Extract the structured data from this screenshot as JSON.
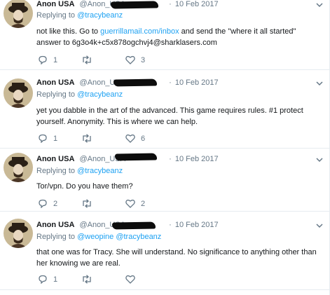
{
  "tweets": [
    {
      "name": "Anon USA",
      "handle": "@Anon_USA",
      "date": "10 Feb 2017",
      "replying_label": "Replying to",
      "mentions": [
        "@tracybeanz"
      ],
      "text_before_link": "not like this. Go to ",
      "link": "guerrillamail.com/inbox",
      "text_after_link": " and send the \"where it all started\" answer to 6g3o4k+c5x878ogchvj4@sharklasers.com",
      "replies": "1",
      "retweets": "",
      "likes": "3"
    },
    {
      "name": "Anon USA",
      "handle": "@Anon_USA",
      "date": "10 Feb 2017",
      "replying_label": "Replying to",
      "mentions": [
        "@tracybeanz"
      ],
      "text": "yet you dabble in the art of the advanced. This game requires rules. #1 protect yourself. Anonymity. This is where we can help.",
      "replies": "1",
      "retweets": "",
      "likes": "6"
    },
    {
      "name": "Anon USA",
      "handle": "@Anon_USA",
      "date": "10 Feb 2017",
      "replying_label": "Replying to",
      "mentions": [
        "@tracybeanz"
      ],
      "text": "Tor/vpn. Do you have them?",
      "replies": "2",
      "retweets": "",
      "likes": "2"
    },
    {
      "name": "Anon USA",
      "handle": "@Anon_USA",
      "date": "10 Feb 2017",
      "replying_label": "Replying to",
      "mentions": [
        "@weopine",
        "@tracybeanz"
      ],
      "text": "that one was for Tracy. She will understand. No significance to anything other than her knowing we are real.",
      "replies": "1",
      "retweets": "",
      "likes": ""
    }
  ],
  "icons": {
    "reply": "reply-icon",
    "retweet": "retweet-icon",
    "like": "heart-icon",
    "more": "chevron-down-icon"
  },
  "colors": {
    "link": "#1da1f2",
    "muted": "#657786",
    "text": "#14171a",
    "divider": "#e6ecf0"
  }
}
